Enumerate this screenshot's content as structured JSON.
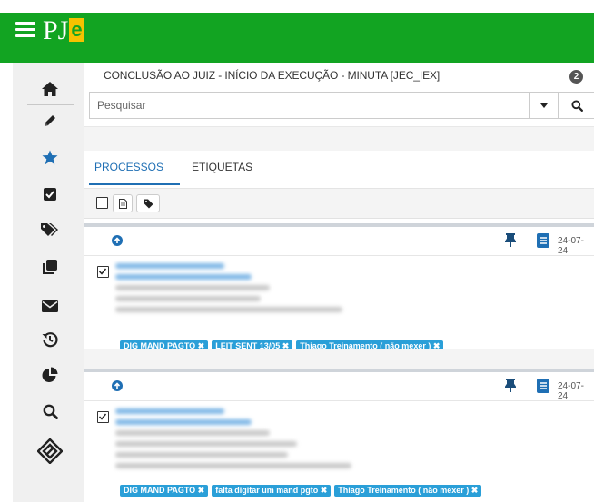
{
  "app": {
    "logo_text": "PJ",
    "logo_e": "e"
  },
  "sidebar": {
    "items": [
      {
        "icon": "home-icon"
      },
      {
        "icon": "pencil-icon"
      },
      {
        "icon": "star-icon"
      },
      {
        "icon": "checkbox-icon"
      },
      {
        "icon": "tags-icon"
      },
      {
        "icon": "copy-icon"
      },
      {
        "icon": "envelope-icon"
      },
      {
        "icon": "history-icon"
      },
      {
        "icon": "pie-chart-icon"
      },
      {
        "icon": "search-icon"
      },
      {
        "icon": "diamond-logo-icon"
      }
    ]
  },
  "header": {
    "title": "CONCLUSÃO AO JUIZ - INÍCIO DA EXECUÇÃO - MINUTA [JEC_IEX]",
    "count": "2"
  },
  "search": {
    "placeholder": "Pesquisar",
    "value": ""
  },
  "tabs": [
    {
      "label": "PROCESSOS"
    },
    {
      "label": "ETIQUETAS"
    }
  ],
  "cards": [
    {
      "date": "24-07-24",
      "tags": [
        "DIG MAND PAGTO ✖",
        "LEIT SENT 13/05 ✖",
        "Thiago Treinamento ( não mexer ) ✖"
      ]
    },
    {
      "date": "24-07-24",
      "tags": [
        "DIG MAND PAGTO ✖",
        "falta digitar um mand pgto ✖",
        "Thiago Treinamento ( não mexer ) ✖"
      ]
    }
  ],
  "colors": {
    "brand_green": "#12a422",
    "accent_blue": "#1f6fb4",
    "tag_blue": "#2a9fd8"
  }
}
